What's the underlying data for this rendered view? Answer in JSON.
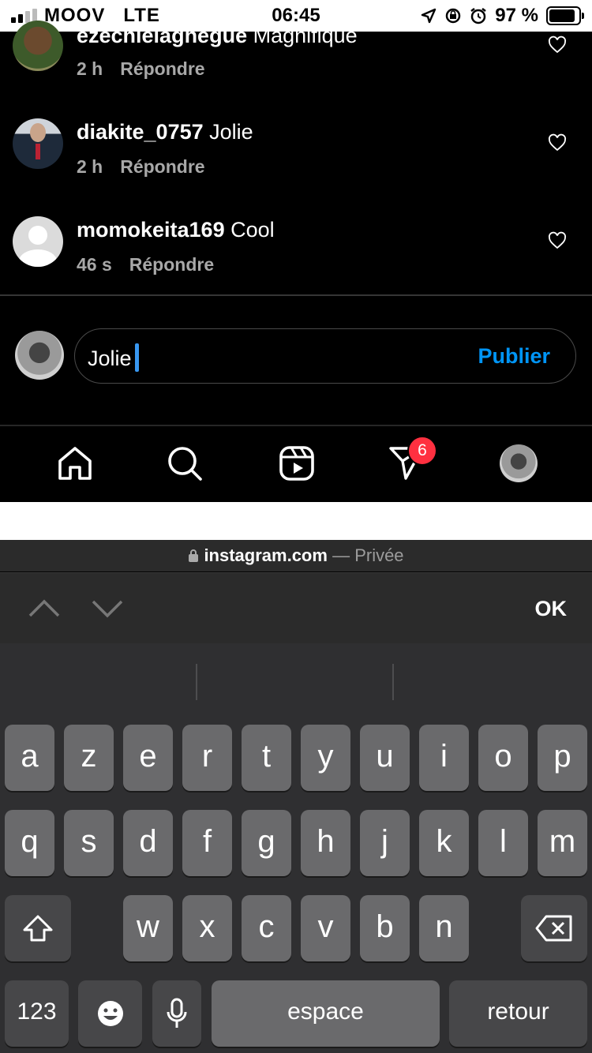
{
  "status_bar": {
    "carrier": "MOOV",
    "network": "LTE",
    "time": "06:45",
    "battery": "97 %"
  },
  "comments": [
    {
      "username": "ezechielaghegue",
      "text": "Magnifique",
      "age": "2 h",
      "reply": "Répondre"
    },
    {
      "username": "diakite_0757",
      "text": "Jolie",
      "age": "2 h",
      "reply": "Répondre"
    },
    {
      "username": "momokeita169",
      "text": "Cool",
      "age": "46 s",
      "reply": "Répondre"
    }
  ],
  "composer": {
    "value": "Jolie",
    "post_label": "Publier"
  },
  "bottom_nav": {
    "icons": [
      "home-icon",
      "search-icon",
      "reels-icon",
      "direct-icon",
      "profile-avatar"
    ],
    "direct_badge": "6"
  },
  "browser": {
    "domain": "instagram.com",
    "separator": "—",
    "mode": "Privée",
    "done_label": "OK"
  },
  "keyboard": {
    "row1": [
      "a",
      "z",
      "e",
      "r",
      "t",
      "y",
      "u",
      "i",
      "o",
      "p"
    ],
    "row2": [
      "q",
      "s",
      "d",
      "f",
      "g",
      "h",
      "j",
      "k",
      "l",
      "m"
    ],
    "row3": [
      "w",
      "x",
      "c",
      "v",
      "b",
      "n"
    ],
    "numbers_key": "123",
    "space_key": "espace",
    "return_key": "retour"
  },
  "colors": {
    "accent": "#0095f6",
    "badge": "#ff3040",
    "caret": "#3897f0"
  }
}
